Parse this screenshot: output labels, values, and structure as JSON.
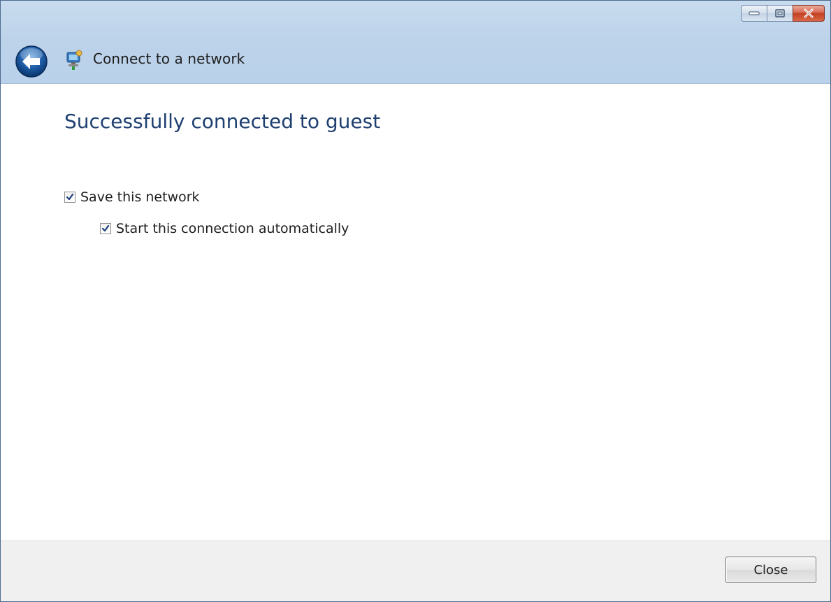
{
  "window": {
    "title": "Connect to a network",
    "controls": {
      "minimize_icon": "minimize-icon",
      "maximize_icon": "maximize-icon",
      "close_icon": "close-icon"
    }
  },
  "main": {
    "heading": "Successfully connected to guest",
    "options": [
      {
        "label": "Save this network",
        "checked": true
      },
      {
        "label": "Start this connection automatically",
        "checked": true
      }
    ]
  },
  "footer": {
    "close_label": "Close"
  },
  "colors": {
    "heading": "#1e3f70",
    "titlebar": "#bdd3ea",
    "footer": "#f0f0f0"
  }
}
